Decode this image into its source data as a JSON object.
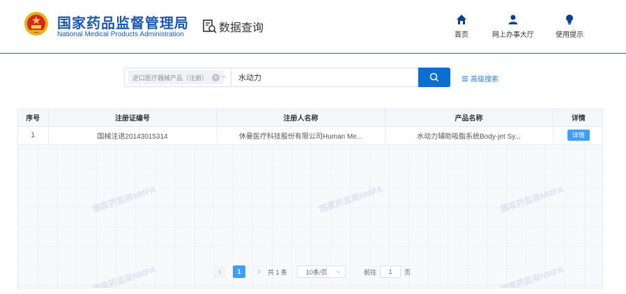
{
  "header": {
    "title_cn": "国家药品监督管理局",
    "title_en": "National Medical Products Administration",
    "section": "数据查询",
    "nav": [
      {
        "label": "首页",
        "icon": "home-icon"
      },
      {
        "label": "网上办事大厅",
        "icon": "user-icon"
      },
      {
        "label": "使用提示",
        "icon": "lightbulb-icon"
      }
    ]
  },
  "search": {
    "category_tag": "进口医疗器械产品（注册）",
    "query": "水动力",
    "advanced_label": "高级搜索"
  },
  "table": {
    "headers": [
      "序号",
      "注册证编号",
      "注册人名称",
      "产品名称",
      "详情"
    ],
    "rows": [
      {
        "index": "1",
        "cert_no": "国械注进20143015314",
        "registrant": "休曼医疗科技股份有限公司Human Me...",
        "product": "水动力辅助吸脂系统Body-jet Sy...",
        "detail": "详情"
      }
    ],
    "watermark": "国家药监局NMPA"
  },
  "pagination": {
    "current_page": "1",
    "total_text": "共 1 条",
    "page_size": "10条/页",
    "goto_prefix": "前往",
    "goto_value": "1",
    "goto_suffix": "页"
  },
  "colors": {
    "brand": "#1b56b0",
    "primary": "#0b6ed1",
    "accent": "#409eff"
  }
}
